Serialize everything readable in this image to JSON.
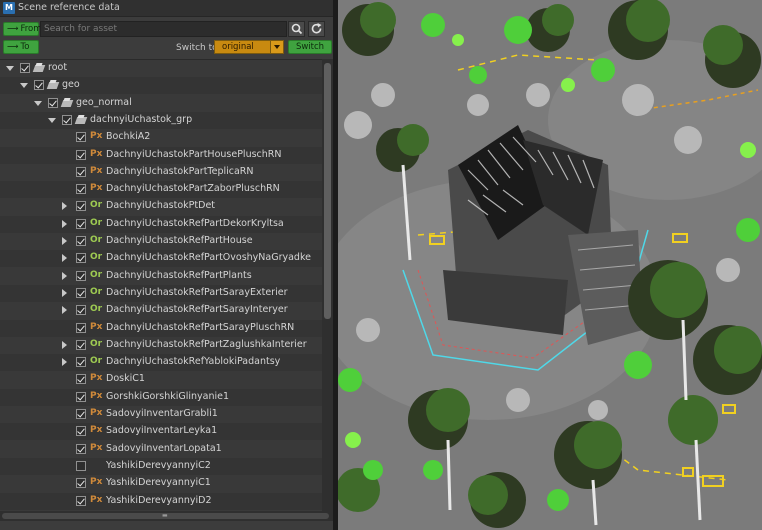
{
  "window": {
    "title": "Scene reference data"
  },
  "toolbar": {
    "from_label": "From",
    "to_label": "To",
    "search_placeholder": "Search for asset",
    "switch_to_label": "Switch to",
    "switch_value": "original",
    "switch_button": "Switch"
  },
  "tree": {
    "rows": [
      {
        "label": "root",
        "tag": "",
        "tagType": "group",
        "depth": 0,
        "expander": "down",
        "checked": true
      },
      {
        "label": "geo",
        "tag": "",
        "tagType": "group",
        "depth": 1,
        "expander": "down",
        "checked": true
      },
      {
        "label": "geo_normal",
        "tag": "",
        "tagType": "group",
        "depth": 2,
        "expander": "down",
        "checked": true
      },
      {
        "label": "dachnyiUchastok_grp",
        "tag": "",
        "tagType": "group",
        "depth": 3,
        "expander": "down",
        "checked": true
      },
      {
        "label": "BochkiA2",
        "tag": "Px",
        "tagType": "px",
        "depth": 4,
        "expander": "",
        "checked": true
      },
      {
        "label": "DachnyiUchastokPartHousePluschRN",
        "tag": "Px",
        "tagType": "px",
        "depth": 4,
        "expander": "",
        "checked": true
      },
      {
        "label": "DachnyiUchastokPartTeplicaRN",
        "tag": "Px",
        "tagType": "px",
        "depth": 4,
        "expander": "",
        "checked": true
      },
      {
        "label": "DachnyiUchastokPartZaborPluschRN",
        "tag": "Px",
        "tagType": "px",
        "depth": 4,
        "expander": "",
        "checked": true
      },
      {
        "label": "DachnyiUchastokPtDet",
        "tag": "Or",
        "tagType": "or",
        "depth": 4,
        "expander": "right",
        "checked": true
      },
      {
        "label": "DachnyiUchastokRefPartDekorKryltsa",
        "tag": "Or",
        "tagType": "or",
        "depth": 4,
        "expander": "right",
        "checked": true
      },
      {
        "label": "DachnyiUchastokRefPartHouse",
        "tag": "Or",
        "tagType": "or",
        "depth": 4,
        "expander": "right",
        "checked": true
      },
      {
        "label": "DachnyiUchastokRefPartOvoshyNaGryadke",
        "tag": "Or",
        "tagType": "or",
        "depth": 4,
        "expander": "right",
        "checked": true
      },
      {
        "label": "DachnyiUchastokRefPartPlants",
        "tag": "Or",
        "tagType": "or",
        "depth": 4,
        "expander": "right",
        "checked": true
      },
      {
        "label": "DachnyiUchastokRefPartSarayExterier",
        "tag": "Or",
        "tagType": "or",
        "depth": 4,
        "expander": "right",
        "checked": true
      },
      {
        "label": "DachnyiUchastokRefPartSarayInteryer",
        "tag": "Or",
        "tagType": "or",
        "depth": 4,
        "expander": "right",
        "checked": true
      },
      {
        "label": "DachnyiUchastokRefPartSarayPluschRN",
        "tag": "Px",
        "tagType": "px",
        "depth": 4,
        "expander": "",
        "checked": true
      },
      {
        "label": "DachnyiUchastokRefPartZaglushkaInterier",
        "tag": "Or",
        "tagType": "or",
        "depth": 4,
        "expander": "right",
        "checked": true
      },
      {
        "label": "DachnyiUchastokRefYablokiPadantsy",
        "tag": "Or",
        "tagType": "or",
        "depth": 4,
        "expander": "right",
        "checked": true
      },
      {
        "label": "DoskiC1",
        "tag": "Px",
        "tagType": "px",
        "depth": 4,
        "expander": "",
        "checked": true
      },
      {
        "label": "GorshkiGorshkiGlinyanie1",
        "tag": "Px",
        "tagType": "px",
        "depth": 4,
        "expander": "",
        "checked": true
      },
      {
        "label": "SadovyiInventarGrabli1",
        "tag": "Px",
        "tagType": "px",
        "depth": 4,
        "expander": "",
        "checked": true
      },
      {
        "label": "SadovyiInventarLeyka1",
        "tag": "Px",
        "tagType": "px",
        "depth": 4,
        "expander": "",
        "checked": true
      },
      {
        "label": "SadovyiInventarLopata1",
        "tag": "Px",
        "tagType": "px",
        "depth": 4,
        "expander": "",
        "checked": true
      },
      {
        "label": "YashikiDerevyannyiC2",
        "tag": "",
        "tagType": "none",
        "depth": 4,
        "expander": "",
        "checked": false
      },
      {
        "label": "YashikiDerevyannyiC1",
        "tag": "Px",
        "tagType": "px",
        "depth": 4,
        "expander": "",
        "checked": true
      },
      {
        "label": "YashikiDerevyannyiD2",
        "tag": "Px",
        "tagType": "px",
        "depth": 4,
        "expander": "",
        "checked": true
      }
    ]
  },
  "colors": {
    "accent_green": "#3fa33f",
    "accent_orange": "#c88a10",
    "tag_px": "#d08a3a",
    "tag_or": "#9ecb52",
    "viewport_ground": "#7d7d7d"
  },
  "icons": {
    "app": "app-icon",
    "search": "search-icon",
    "refresh": "refresh-icon",
    "group": "group-icon"
  }
}
